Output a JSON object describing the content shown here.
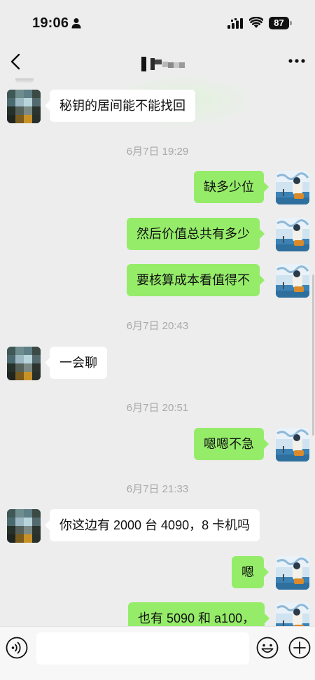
{
  "status_bar": {
    "time": "19:06",
    "battery": "87"
  },
  "header": {
    "back_icon": "chevron-left-icon",
    "title": "",
    "more_icon": "more-dots-icon"
  },
  "colors": {
    "background": "#ededed",
    "incoming_bubble": "#ffffff",
    "outgoing_bubble": "#95ec69",
    "timestamp_text": "#a8a8a8"
  },
  "messages": [
    {
      "type": "incoming",
      "text": "秘钥的居间能不能找回"
    },
    {
      "type": "time",
      "text": "6月7日 19:29"
    },
    {
      "type": "outgoing",
      "text": "缺多少位"
    },
    {
      "type": "outgoing",
      "text": "然后价值总共有多少"
    },
    {
      "type": "outgoing",
      "text": "要核算成本看值得不"
    },
    {
      "type": "time",
      "text": "6月7日 20:43"
    },
    {
      "type": "incoming",
      "text": "一会聊"
    },
    {
      "type": "time",
      "text": "6月7日 20:51"
    },
    {
      "type": "outgoing",
      "text": "嗯嗯不急"
    },
    {
      "type": "time",
      "text": "6月7日 21:33"
    },
    {
      "type": "incoming",
      "text": "你这边有 2000 台 4090，8 卡机吗"
    },
    {
      "type": "outgoing",
      "text": "嗯"
    },
    {
      "type": "outgoing",
      "text": "也有 5090 和  a100，"
    }
  ],
  "input_bar": {
    "voice_icon": "voice-icon",
    "input_value": "",
    "emoji_icon": "emoji-icon",
    "plus_icon": "plus-icon"
  }
}
